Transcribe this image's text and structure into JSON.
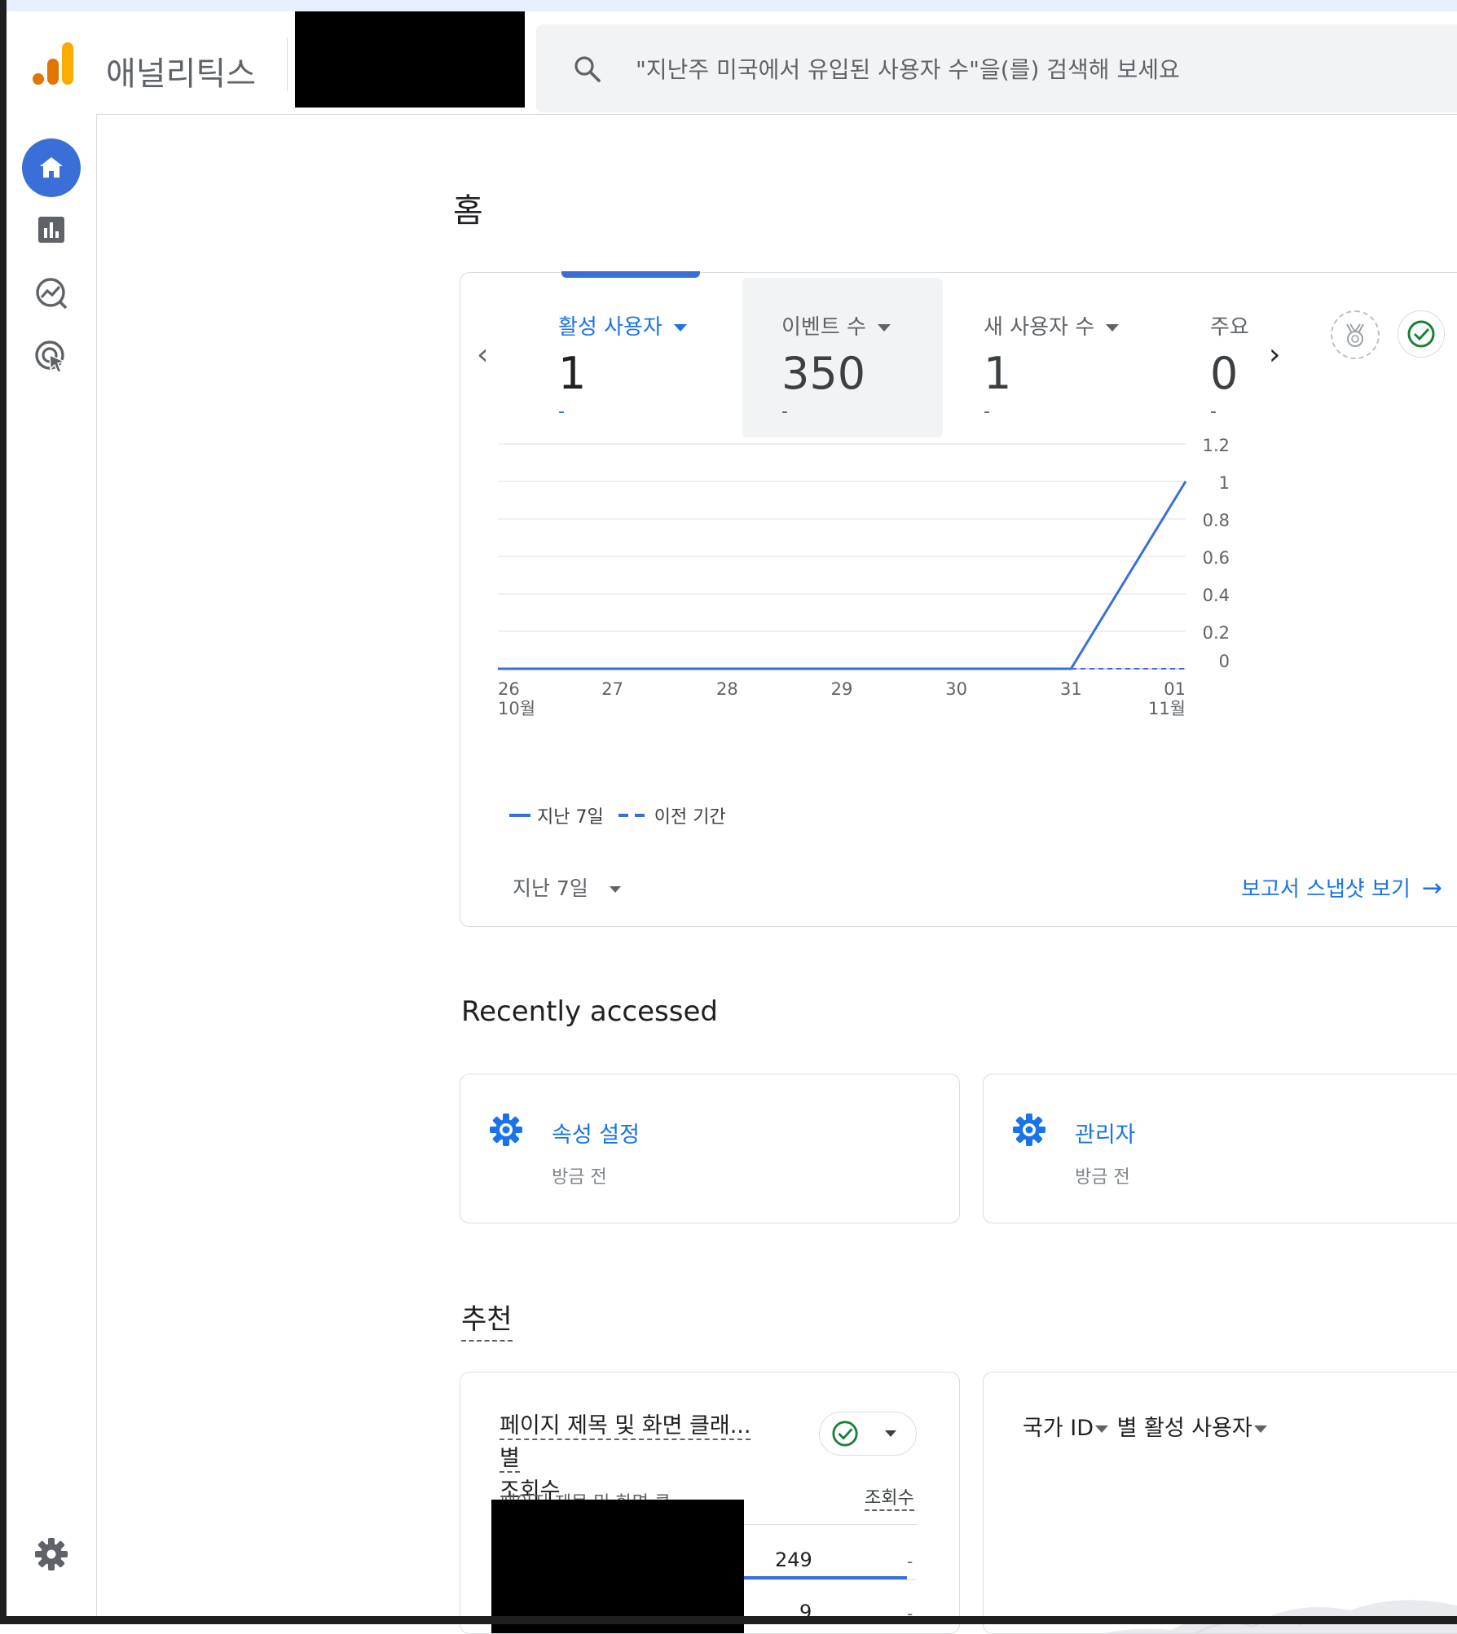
{
  "app": {
    "brand": "애널리틱스"
  },
  "search": {
    "placeholder": "\"지난주 미국에서 유입된 사용자 수\"을(를) 검색해 보세요"
  },
  "nav": [
    {
      "name": "home",
      "icon": "home-icon",
      "active": true
    },
    {
      "name": "reports",
      "icon": "bar-chart-icon"
    },
    {
      "name": "explore",
      "icon": "explore-icon"
    },
    {
      "name": "advertising",
      "icon": "advertising-icon"
    },
    {
      "name": "admin",
      "icon": "gear-icon"
    }
  ],
  "page": {
    "title": "홈"
  },
  "kpis": [
    {
      "label": "활성 사용자",
      "value": "1",
      "delta": "-"
    },
    {
      "label": "이벤트 수",
      "value": "350",
      "delta": "-"
    },
    {
      "label": "새 사용자 수",
      "value": "1",
      "delta": "-"
    },
    {
      "label": "주요",
      "value": "0",
      "delta": "-"
    }
  ],
  "chart_data": {
    "type": "line",
    "x": [
      "26",
      "27",
      "28",
      "29",
      "30",
      "31",
      "01"
    ],
    "x_sublabels": {
      "26": "10월",
      "01": "11월"
    },
    "series": [
      {
        "name": "지난 7일",
        "style": "solid",
        "values": [
          0,
          0,
          0,
          0,
          0,
          0,
          1
        ]
      },
      {
        "name": "이전 기간",
        "style": "dashed",
        "values": [
          0,
          0,
          0,
          0,
          0,
          0,
          0
        ]
      }
    ],
    "yticks": [
      "1.2",
      "1",
      "0.8",
      "0.6",
      "0.4",
      "0.2",
      "0"
    ],
    "ylim": [
      0,
      1.2
    ],
    "y_axis_side": "right",
    "grid": true,
    "legend_position": "bottom-left",
    "color": "#3b6fd8"
  },
  "legend": {
    "current": "지난 7일",
    "previous": "이전 기간"
  },
  "period": {
    "label": "지난 7일"
  },
  "snapshot": {
    "label": "보고서 스냅샷 보기"
  },
  "recent": {
    "title": "Recently accessed",
    "items": [
      {
        "title": "속성 설정",
        "time": "방금 전"
      },
      {
        "title": "관리자",
        "time": "방금 전"
      }
    ]
  },
  "recommend": {
    "title": "추천",
    "card1": {
      "title_line1": "페이지 제목 및 화면 클래... 별",
      "title_line2": "조회수",
      "col_left": "페이지 제목 및 화면 클",
      "col_right": "조회수",
      "rows": [
        {
          "value": "249",
          "delta": "-"
        },
        {
          "value": "9",
          "delta": "-"
        }
      ]
    },
    "card2": {
      "title_a": "국가 ID",
      "title_b": " 별 활성 사용자"
    }
  },
  "colors": {
    "accent": "#1a73e8",
    "chart_blue": "#3b6fd8",
    "check_green": "#188038",
    "logo_orange": "#f9ab00",
    "logo_dark": "#e37400"
  }
}
